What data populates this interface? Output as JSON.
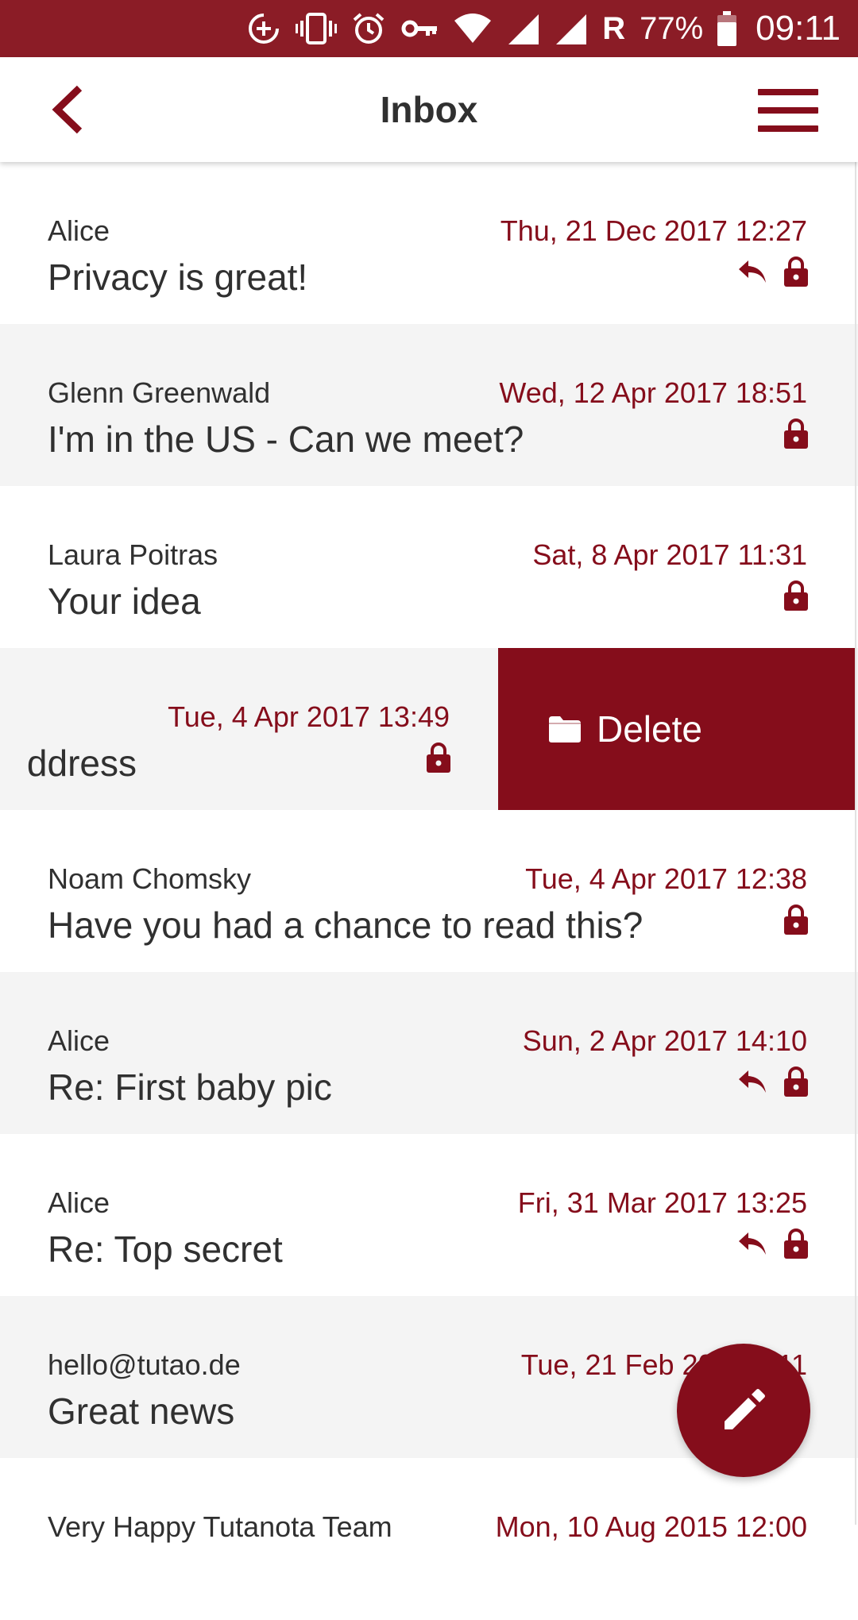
{
  "status_bar": {
    "network_roaming": "R",
    "battery": "77%",
    "time": "09:11",
    "icons": [
      "data-saver-icon",
      "vibrate-icon",
      "alarm-icon",
      "vpn-key-icon",
      "wifi-icon",
      "signal-icon",
      "signal-icon",
      "battery-icon"
    ]
  },
  "header": {
    "title": "Inbox",
    "back_icon": "chevron-left-icon",
    "menu_icon": "hamburger-menu-icon"
  },
  "colors": {
    "brand": "#850d1b",
    "status_bar": "#8b1c26",
    "row_alt": "#f4f4f4",
    "text": "#303030"
  },
  "mails": [
    {
      "sender": "Alice",
      "subject": "Privacy is great!",
      "date": "Thu, 21 Dec 2017 12:27",
      "replied": true,
      "encrypted": true
    },
    {
      "sender": "Glenn Greenwald",
      "subject": "I'm in the US - Can we meet?",
      "date": "Wed, 12 Apr 2017 18:51",
      "replied": false,
      "encrypted": true
    },
    {
      "sender": "Laura Poitras",
      "subject": "Your idea",
      "date": "Sat, 8 Apr 2017 11:31",
      "replied": false,
      "encrypted": true
    },
    {
      "sender": "",
      "subject": "ddress",
      "date": "Tue, 4 Apr 2017 13:49",
      "replied": false,
      "encrypted": true,
      "swiped": true
    },
    {
      "sender": "Noam Chomsky",
      "subject": "Have you had a chance to read this?",
      "date": "Tue, 4 Apr 2017 12:38",
      "replied": false,
      "encrypted": true
    },
    {
      "sender": "Alice",
      "subject": "Re: First baby pic",
      "date": "Sun, 2 Apr 2017 14:10",
      "replied": true,
      "encrypted": true
    },
    {
      "sender": "Alice",
      "subject": "Re: Top secret",
      "date": "Fri, 31 Mar 2017 13:25",
      "replied": true,
      "encrypted": true
    },
    {
      "sender": "hello@tutao.de",
      "subject": "Great news",
      "date": "Tue, 21 Feb 2017 ..:11",
      "replied": false,
      "encrypted": false
    },
    {
      "sender": "Very Happy Tutanota Team",
      "subject": "",
      "date": "Mon, 10 Aug 2015 12:00",
      "replied": false,
      "encrypted": false
    }
  ],
  "swipe_action": {
    "label": "Delete",
    "icon": "folder-icon"
  },
  "fab": {
    "icon": "pencil-icon",
    "action": "compose"
  }
}
